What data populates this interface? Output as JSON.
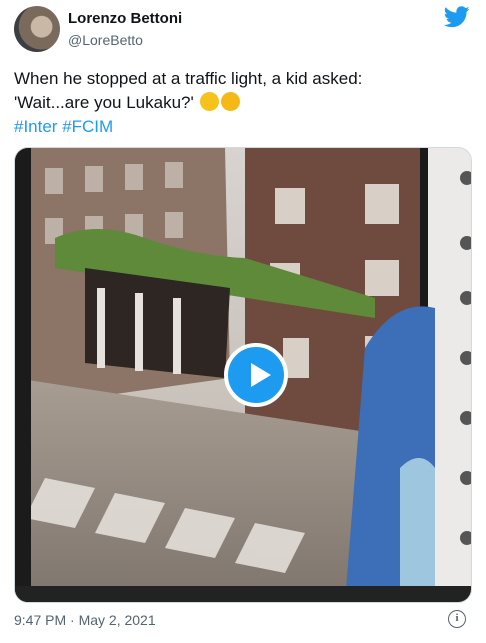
{
  "author": {
    "name": "Lorenzo Bettoni",
    "handle": "@LoreBetto"
  },
  "tweet": {
    "line1": "When he stopped at a traffic light, a kid asked:",
    "line2": "'Wait...are you Lukaku?'",
    "emojis": [
      "grinning-sweat-emoji",
      "rofl-emoji"
    ],
    "hashtags": "#Inter #FCIM"
  },
  "footer": {
    "timestamp": "9:47 PM · May 2, 2021"
  },
  "colors": {
    "accent": "#1d9bf0",
    "secondary_text": "#536471"
  }
}
